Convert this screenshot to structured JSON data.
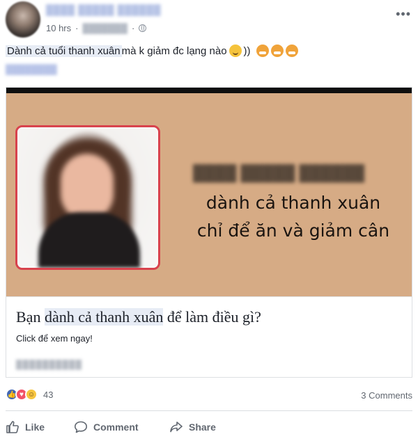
{
  "post": {
    "timestamp": "10 hrs",
    "text_highlight": "Dành cả tuổi thanh xuân",
    "text_rest": " mà k giảm đc lạng nào ",
    "text_after_emoji": "))"
  },
  "card": {
    "headline_line1": "dành cả thanh xuân",
    "headline_line2": "chỉ để ăn và giảm cân",
    "title_before": "Bạn ",
    "title_highlight": "dành cả thanh xuân",
    "title_after": " để làm điều gì?",
    "description": "Click để xem ngay!"
  },
  "reactions": {
    "count": "43",
    "comments": "3 Comments"
  },
  "actions": {
    "like": "Like",
    "comment": "Comment",
    "share": "Share"
  },
  "icons": [
    "globe-icon",
    "more-icon",
    "smile-emoji-icon",
    "angry-emoji-icon",
    "like-reaction-icon",
    "love-reaction-icon",
    "haha-reaction-icon",
    "thumbs-up-icon",
    "comment-icon",
    "share-icon"
  ],
  "colors": {
    "card_background": "#d6ab85",
    "photo_border": "#d8424d",
    "link_highlight": "#e7ecf5",
    "action_text": "#616770"
  }
}
